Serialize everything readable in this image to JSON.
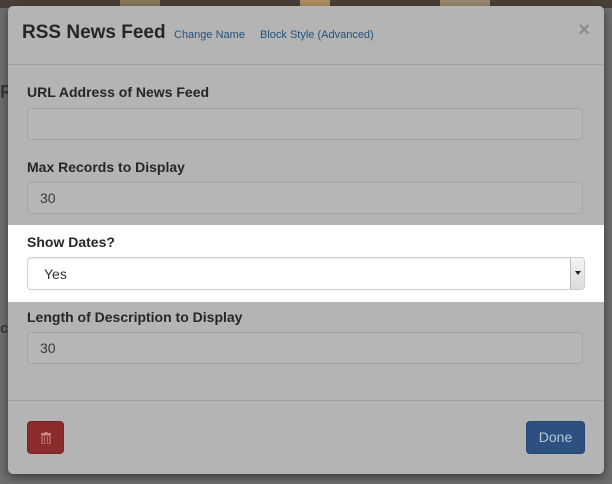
{
  "modal": {
    "title": "RSS News Feed",
    "header_links": [
      "Change Name",
      "Block Style (Advanced)"
    ],
    "close": "×"
  },
  "fields": {
    "url": {
      "label": "URL Address of News Feed",
      "value": ""
    },
    "max_records": {
      "label": "Max Records to Display",
      "value": "30"
    },
    "show_dates": {
      "label": "Show Dates?",
      "value": "Yes"
    },
    "description_length": {
      "label": "Length of Description to Display",
      "value": "30"
    }
  },
  "footer": {
    "delete_icon": "trash-icon",
    "done_label": "Done"
  },
  "colors": {
    "overlay_dim": "#b4b4b4",
    "highlight": "#ffffff",
    "delete_button": "#8b2b2b",
    "done_button": "#2c5180",
    "link": "#23527c"
  }
}
